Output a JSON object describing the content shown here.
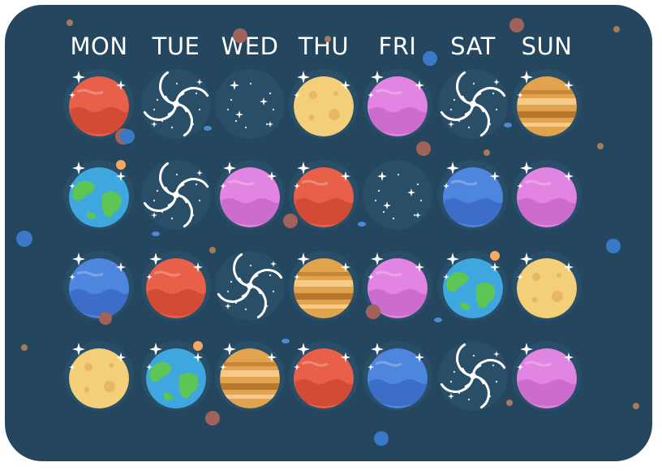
{
  "days": [
    "MON",
    "TUE",
    "WED",
    "THU",
    "FRI",
    "SAT",
    "SUN"
  ],
  "weeks": [
    [
      "mars",
      "galaxy",
      "stars",
      "moon",
      "pink",
      "galaxy",
      "jupiter"
    ],
    [
      "earth",
      "galaxy",
      "pink",
      "mars",
      "stars",
      "neptune",
      "pink"
    ],
    [
      "neptune",
      "mars",
      "galaxy",
      "jupiter",
      "pink",
      "earth",
      "moon"
    ],
    [
      "moon",
      "earth",
      "jupiter",
      "mars",
      "neptune",
      "galaxy",
      "pink"
    ]
  ],
  "colors": {
    "board": "#24465e",
    "mars": "#e8604a",
    "moon": "#f4cf7a",
    "pink": "#e285e2",
    "neptune": "#4f86dd",
    "jupiter": "#e2a34f",
    "earth": "#3fa7e0",
    "continent": "#5cc553"
  }
}
